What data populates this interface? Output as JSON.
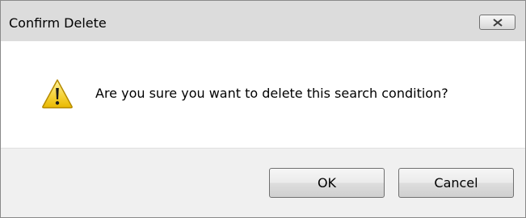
{
  "dialog": {
    "title": "Confirm Delete",
    "message": "Are you sure you want to delete this search condition?",
    "icon": "warning-icon",
    "buttons": {
      "ok": "OK",
      "cancel": "Cancel"
    }
  },
  "colors": {
    "warning_fill": "#f6d43c",
    "warning_border": "#b58a00",
    "titlebar_bg": "#dcdcdc",
    "content_bg": "#ffffff",
    "footer_bg": "#f0f0f0"
  }
}
